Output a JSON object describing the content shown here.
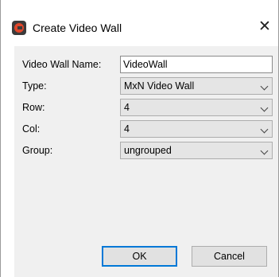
{
  "window": {
    "title": "Create Video Wall",
    "close_label": "✕"
  },
  "form": {
    "name": {
      "label": "Video Wall Name:",
      "value": "VideoWall"
    },
    "type": {
      "label": "Type:",
      "value": "MxN Video Wall"
    },
    "row": {
      "label": "Row:",
      "value": "4"
    },
    "col": {
      "label": "Col:",
      "value": "4"
    },
    "group": {
      "label": "Group:",
      "value": "ungrouped"
    }
  },
  "buttons": {
    "ok": "OK",
    "cancel": "Cancel"
  }
}
